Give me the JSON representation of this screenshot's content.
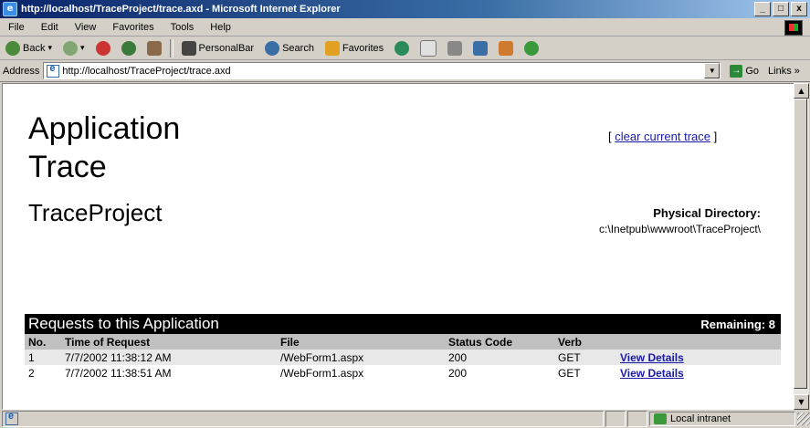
{
  "window": {
    "title": "http://localhost/TraceProject/trace.axd - Microsoft Internet Explorer",
    "buttons": [
      "_",
      "□",
      "x"
    ]
  },
  "menu": [
    "File",
    "Edit",
    "View",
    "Favorites",
    "Tools",
    "Help"
  ],
  "toolbar": {
    "back": "Back",
    "personal_bar": "PersonalBar",
    "search": "Search",
    "favorites": "Favorites"
  },
  "address": {
    "label": "Address",
    "url": "http://localhost/TraceProject/trace.axd",
    "go": "Go",
    "links": "Links »"
  },
  "page": {
    "title_line1": "Application",
    "title_line2": "Trace",
    "app_name": "TraceProject",
    "clear_prefix": "[ ",
    "clear_link": "clear current trace",
    "clear_suffix": " ]",
    "physical_label": "Physical Directory:",
    "physical_path": "c:\\Inetpub\\wwwroot\\TraceProject\\"
  },
  "requests": {
    "header": "Requests to this Application",
    "remaining": "Remaining: 8",
    "columns": [
      "No.",
      "Time of Request",
      "File",
      "Status Code",
      "Verb",
      ""
    ],
    "rows": [
      {
        "no": "1",
        "time": "7/7/2002 11:38:12 AM",
        "file": "/WebForm1.aspx",
        "status": "200",
        "verb": "GET",
        "action": "View Details"
      },
      {
        "no": "2",
        "time": "7/7/2002 11:38:51 AM",
        "file": "/WebForm1.aspx",
        "status": "200",
        "verb": "GET",
        "action": "View Details"
      }
    ]
  },
  "status": {
    "zone": "Local intranet"
  }
}
